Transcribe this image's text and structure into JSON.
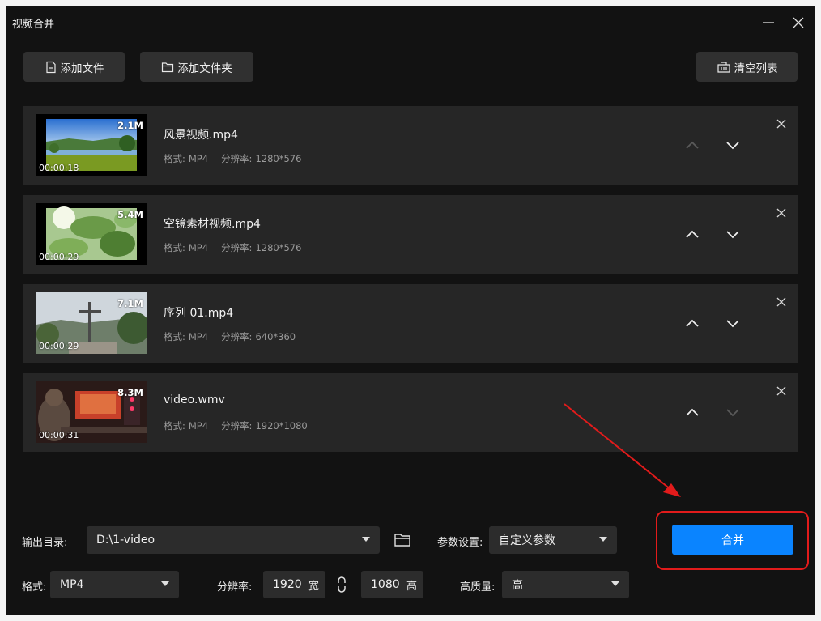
{
  "window": {
    "title": "视频合并",
    "minimize_icon": "minimize-icon",
    "close_icon": "close-icon"
  },
  "toolbar": {
    "add_file_label": "添加文件",
    "add_folder_label": "添加文件夹",
    "clear_list_label": "清空列表"
  },
  "files": [
    {
      "name": "风景视频.mp4",
      "size": "2.1M",
      "duration": "00:00:18",
      "format_label": "格式:",
      "format": "MP4",
      "resolution_label": "分辨率:",
      "resolution": "1280*576"
    },
    {
      "name": "空镜素材视频.mp4",
      "size": "5.4M",
      "duration": "00:00:29",
      "format_label": "格式:",
      "format": "MP4",
      "resolution_label": "分辨率:",
      "resolution": "1280*576"
    },
    {
      "name": "序列 01.mp4",
      "size": "7.1M",
      "duration": "00:00:29",
      "format_label": "格式:",
      "format": "MP4",
      "resolution_label": "分辨率:",
      "resolution": "640*360"
    },
    {
      "name": "video.wmv",
      "size": "8.3M",
      "duration": "00:00:31",
      "format_label": "格式:",
      "format": "MP4",
      "resolution_label": "分辨率:",
      "resolution": "1920*1080"
    }
  ],
  "settings": {
    "output_dir_label": "输出目录:",
    "output_dir_value": "D:\\1-video",
    "params_label": "参数设置:",
    "params_value": "自定义参数",
    "format_label": "格式:",
    "format_value": "MP4",
    "resolution_label": "分辨率:",
    "width_value": "1920",
    "width_unit": "宽",
    "height_value": "1080",
    "height_unit": "高",
    "quality_label": "高质量:",
    "quality_value": "高"
  },
  "actions": {
    "merge_label": "合并"
  },
  "colors": {
    "accent": "#0a84ff",
    "annotation": "#e21b1b",
    "background": "#121212",
    "row": "#262626"
  }
}
